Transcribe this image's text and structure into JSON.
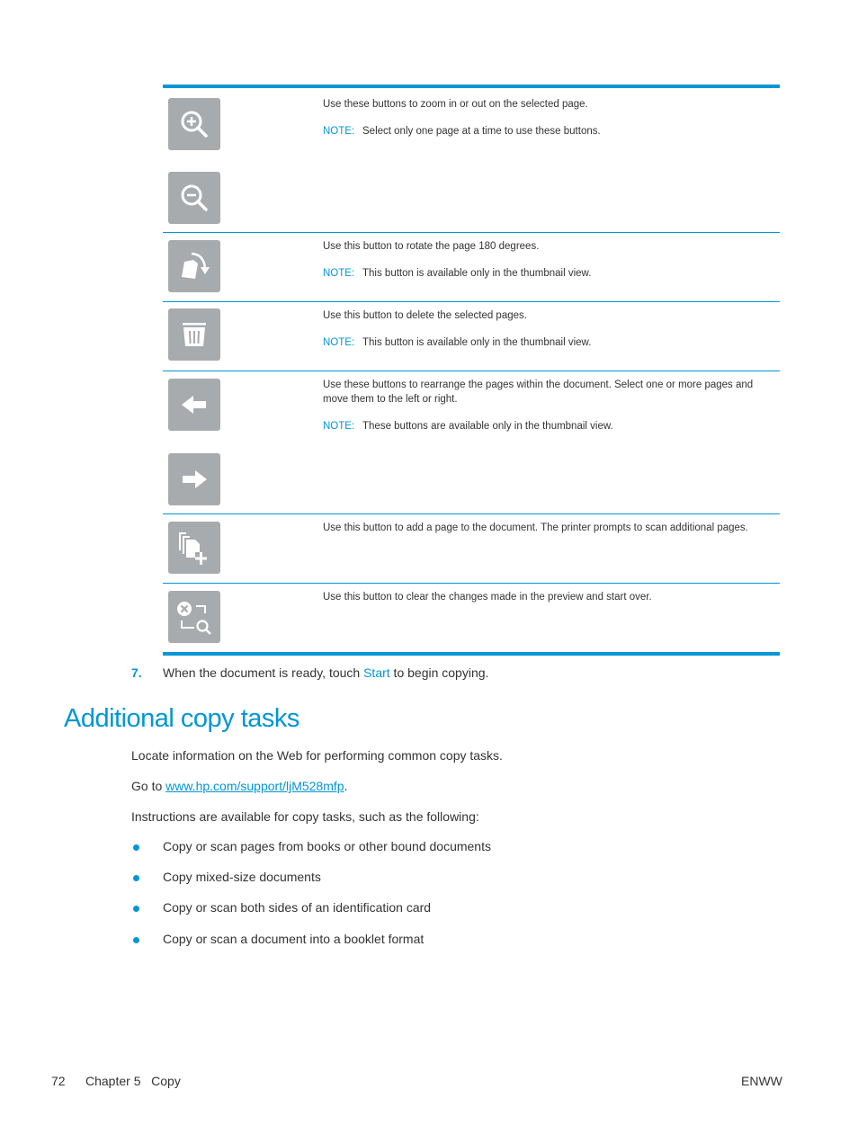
{
  "table": {
    "rows": [
      {
        "description": "Use these buttons to zoom in or out on the selected page.",
        "note_label": "NOTE:",
        "note": "Select only one page at a time to use these buttons.",
        "icons": [
          "zoom-in-icon",
          "zoom-out-icon"
        ]
      },
      {
        "description": "Use this button to rotate the page 180 degrees.",
        "note_label": "NOTE:",
        "note": "This button is available only in the thumbnail view.",
        "icons": [
          "rotate-page-icon"
        ]
      },
      {
        "description": "Use this button to delete the selected pages.",
        "note_label": "NOTE:",
        "note": "This button is available only in the thumbnail view.",
        "icons": [
          "trash-icon"
        ]
      },
      {
        "description": "Use these buttons to rearrange the pages within the document. Select one or more pages and move them to the left or right.",
        "note_label": "NOTE:",
        "note": "These buttons are available only in the thumbnail view.",
        "icons": [
          "arrow-left-icon",
          "arrow-right-icon"
        ]
      },
      {
        "description": "Use this button to add a page to the document. The printer prompts to scan additional pages.",
        "icons": [
          "add-page-icon"
        ]
      },
      {
        "description": "Use this button to clear the changes made in the preview and start over.",
        "icons": [
          "clear-preview-icon"
        ]
      }
    ]
  },
  "step": {
    "number": "7.",
    "text_before": "When the document is ready, touch ",
    "highlight": "Start",
    "text_after": " to begin copying."
  },
  "section": {
    "title": "Additional copy tasks",
    "intro": "Locate information on the Web for performing common copy tasks.",
    "goto_prefix": "Go to ",
    "link": "www.hp.com/support/ljM528mfp",
    "goto_suffix": ".",
    "instructions": "Instructions are available for copy tasks, such as the following:",
    "bullets": [
      "Copy or scan pages from books or other bound documents",
      "Copy mixed-size documents",
      "Copy or scan both sides of an identification card",
      "Copy or scan a document into a booklet format"
    ]
  },
  "footer": {
    "page_number": "72",
    "chapter": "Chapter 5   Copy",
    "right": "ENWW"
  }
}
